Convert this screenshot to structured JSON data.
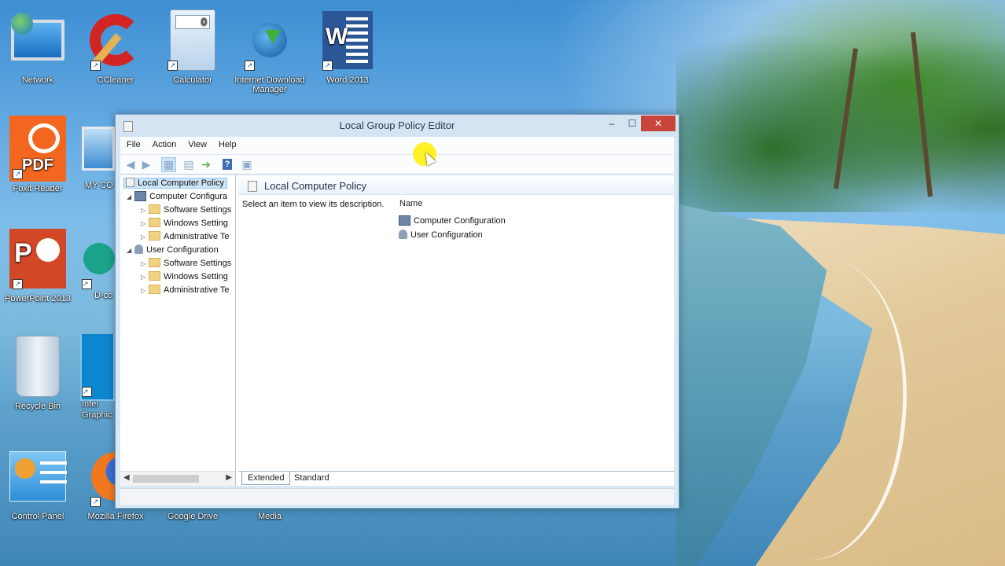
{
  "desktop": {
    "icons": [
      {
        "label": "Network",
        "icon": "network-icon"
      },
      {
        "label": "CCleaner",
        "icon": "ccleaner-icon"
      },
      {
        "label": "Calculator",
        "icon": "calculator-icon"
      },
      {
        "label": "Internet Download Manager",
        "icon": "idm-icon"
      },
      {
        "label": "Word 2013",
        "icon": "word-icon"
      },
      {
        "label": "Foxit Reader",
        "icon": "foxit-icon"
      },
      {
        "label": "MY CO",
        "icon": "computer-icon"
      },
      {
        "label": "PowerPoint 2013",
        "icon": "powerpoint-icon"
      },
      {
        "label": "D-co",
        "icon": "app-icon"
      },
      {
        "label": "Recycle Bin",
        "icon": "recycle-bin-icon"
      },
      {
        "label": "Intel Graphic",
        "icon": "intel-graphics-icon"
      },
      {
        "label": "Control Panel",
        "icon": "control-panel-icon"
      },
      {
        "label": "Mozilla Firefox",
        "icon": "firefox-icon"
      },
      {
        "label": "Google Drive",
        "icon": "google-drive-icon"
      },
      {
        "label": "Media",
        "icon": "media-icon"
      }
    ],
    "icon_text": {
      "pdf": "PDF",
      "word": "W",
      "ppt": "P",
      "calc_display": "0"
    }
  },
  "window": {
    "title": "Local Group Policy Editor",
    "controls": {
      "minimize": "–",
      "maximize": "☐",
      "close": "✕"
    },
    "menu": [
      "File",
      "Action",
      "View",
      "Help"
    ],
    "toolbar": [
      "back-icon",
      "forward-icon",
      "show-hide-tree-icon",
      "properties-icon",
      "export-list-icon",
      "help-icon",
      "show-hide-action-pane-icon"
    ],
    "tree": {
      "root": "Local Computer Policy",
      "computer": {
        "label": "Computer Configura",
        "children": [
          "Software Settings",
          "Windows Setting",
          "Administrative Te"
        ]
      },
      "user": {
        "label": "User Configuration",
        "children": [
          "Software Settings",
          "Windows Setting",
          "Administrative Te"
        ]
      }
    },
    "right_pane": {
      "header": "Local Computer Policy",
      "description": "Select an item to view its description.",
      "column_name": "Name",
      "items": [
        "Computer Configuration",
        "User Configuration"
      ]
    },
    "tabs": [
      "Extended",
      "Standard"
    ]
  }
}
